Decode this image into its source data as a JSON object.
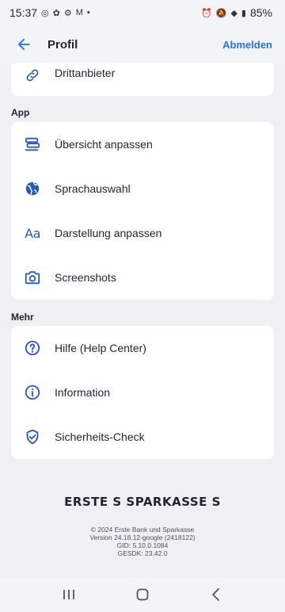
{
  "status_bar": {
    "time": "15:37",
    "battery": "85%"
  },
  "app_bar": {
    "title": "Profil",
    "logout_label": "Abmelden"
  },
  "top_card": {
    "items": [
      {
        "label": "Drittanbieter",
        "icon": "link-icon"
      }
    ]
  },
  "section_app": {
    "heading": "App",
    "items": [
      {
        "label": "Übersicht anpassen",
        "icon": "dashboard-customize-icon"
      },
      {
        "label": "Sprachauswahl",
        "icon": "globe-icon"
      },
      {
        "label": "Darstellung anpassen",
        "icon": "text-size-icon",
        "glyph": "Aa"
      },
      {
        "label": "Screenshots",
        "icon": "camera-icon"
      }
    ]
  },
  "section_more": {
    "heading": "Mehr",
    "items": [
      {
        "label": "Hilfe (Help Center)",
        "icon": "help-circle-icon"
      },
      {
        "label": "Information",
        "icon": "info-circle-icon"
      },
      {
        "label": "Sicherheits-Check",
        "icon": "shield-check-icon"
      }
    ]
  },
  "footer": {
    "brand": "ERSTE S SPARKASSE S",
    "copyright": "© 2024 Erste Bank und Sparkasse",
    "version": "Version 24.18.12-google (2418122)",
    "gid": "GID: 5.10.0.1084",
    "gesdk": "GESDK: 23.42.0"
  },
  "colors": {
    "accent": "#2870ed",
    "icon": "#2a5bb5",
    "background": "#eef0f4"
  }
}
